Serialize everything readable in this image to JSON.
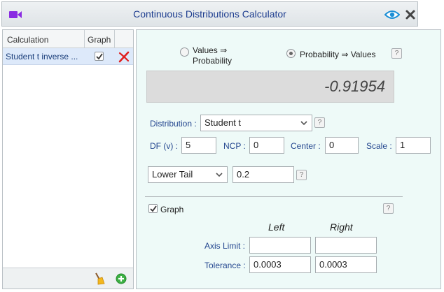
{
  "window": {
    "title": "Continuous Distributions Calculator"
  },
  "left_panel": {
    "columns": [
      "Calculation",
      "Graph"
    ],
    "rows": [
      {
        "label": "Student t inverse ...",
        "graph_checked": true
      }
    ]
  },
  "mode": {
    "option1_line1": "Values ⇒",
    "option1_line2": "Probability",
    "option2": "Probability ⇒ Values",
    "selected": "Probability ⇒ Values"
  },
  "result": {
    "value": "-0.91954"
  },
  "distribution": {
    "label": "Distribution :",
    "selected": "Student t"
  },
  "params": {
    "df_label": "DF (v) :",
    "df_value": "5",
    "ncp_label": "NCP :",
    "ncp_value": "0",
    "center_label": "Center :",
    "center_value": "0",
    "scale_label": "Scale :",
    "scale_value": "1"
  },
  "tail": {
    "selected": "Lower Tail",
    "probability": "0.2"
  },
  "graph": {
    "label": "Graph",
    "checked": true,
    "left_header": "Left",
    "right_header": "Right",
    "axis_limit_label": "Axis Limit :",
    "axis_limit_left": "",
    "axis_limit_right": "",
    "tolerance_label": "Tolerance :",
    "tolerance_left": "0.0003",
    "tolerance_right": "0.0003"
  },
  "colors": {
    "title": "#1d3d8f",
    "selected_row": "#dde9fa",
    "right_panel_bg": "#eefaf8",
    "label_blue": "#23468f"
  }
}
